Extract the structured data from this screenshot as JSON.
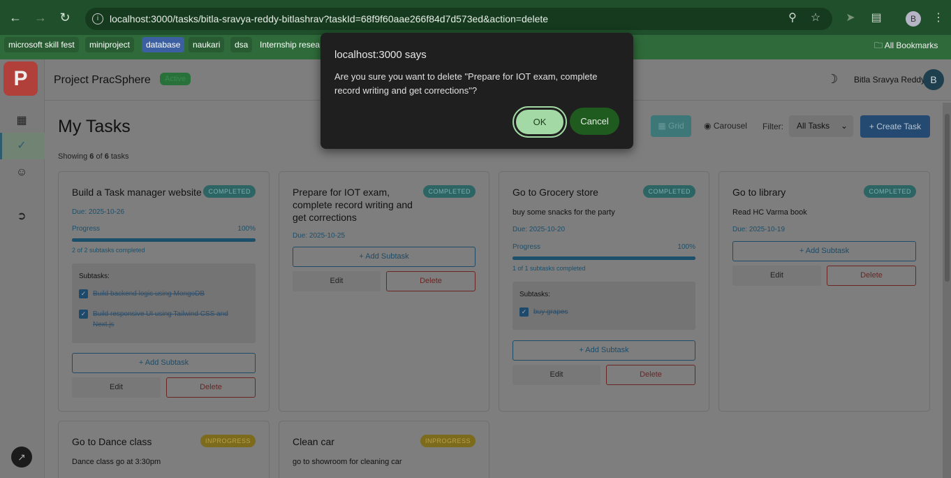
{
  "browser": {
    "url": "localhost:3000/tasks/bitla-sravya-reddy-bitlashrav?taskId=68f9f60aae266f84d7d573ed&action=delete",
    "profile_initial": "B",
    "bookmarks": [
      "microsoft skill fest",
      "miniproject",
      "database",
      "naukari",
      "dsa",
      "Internship resea"
    ],
    "all_bookmarks": "All Bookmarks"
  },
  "app": {
    "logo_letter": "P",
    "title": "Project PracSphere",
    "status": "Active",
    "user_name": "Bitla Sravya Reddy",
    "user_initial": "B"
  },
  "page": {
    "title": "My Tasks",
    "showing_prefix": "Showing ",
    "showing_count": "6",
    "showing_mid": " of ",
    "showing_total": "6",
    "showing_suffix": " tasks",
    "view_grid": "Grid",
    "view_carousel": "Carousel",
    "filter_label": "Filter:",
    "filter_value": "All Tasks",
    "create_button": "+ Create Task"
  },
  "tasks": [
    {
      "title": "Build a Task manager website",
      "status": "COMPLETED",
      "due": "Due: 2025-10-26",
      "progress_label": "Progress",
      "progress_pct": "100%",
      "progress": 1.0,
      "subtask_count": "2 of 2 subtasks completed",
      "subtasks_heading": "Subtasks:",
      "subtasks": [
        "Build backend logic using MongoDB",
        "Build responsive UI using Tailwind CSS and Next.js"
      ],
      "add_subtask": "+ Add Subtask",
      "edit": "Edit",
      "delete": "Delete"
    },
    {
      "title": "Prepare for IOT exam, complete record writing and get corrections",
      "status": "COMPLETED",
      "due": "Due: 2025-10-25",
      "add_subtask": "+ Add Subtask",
      "edit": "Edit",
      "delete": "Delete"
    },
    {
      "title": "Go to Grocery store",
      "status": "COMPLETED",
      "description": "buy some snacks for the party",
      "due": "Due: 2025-10-20",
      "progress_label": "Progress",
      "progress_pct": "100%",
      "progress": 1.0,
      "subtask_count": "1 of 1 subtasks completed",
      "subtasks_heading": "Subtasks:",
      "subtasks": [
        "buy grapes"
      ],
      "add_subtask": "+ Add Subtask",
      "edit": "Edit",
      "delete": "Delete"
    },
    {
      "title": "Go to library",
      "status": "COMPLETED",
      "description": "Read HC Varma book",
      "due": "Due: 2025-10-19",
      "add_subtask": "+ Add Subtask",
      "edit": "Edit",
      "delete": "Delete"
    },
    {
      "title": "Go to Dance class",
      "status": "INPROGRESS",
      "description": "Dance class go at 3:30pm"
    },
    {
      "title": "Clean car",
      "status": "INPROGRESS",
      "description": "go to showroom for cleaning car"
    }
  ],
  "dialog": {
    "title": "localhost:3000 says",
    "message": "Are you sure you want to delete \"Prepare for IOT exam, complete record writing and get corrections\"?",
    "ok": "OK",
    "cancel": "Cancel"
  },
  "icons": {
    "back": "arrow-left-icon",
    "forward": "arrow-right-icon",
    "reload": "reload-icon",
    "zoom": "magnifier-icon",
    "star": "star-icon",
    "extensions": "puzzle-icon",
    "theme": "moon-icon"
  },
  "colors": {
    "dialog_bg": "#1f1f1f",
    "ok_button": "#a3d9a5",
    "cancel_button": "#1f5a1f",
    "chrome_green": "#2f6b3a"
  }
}
